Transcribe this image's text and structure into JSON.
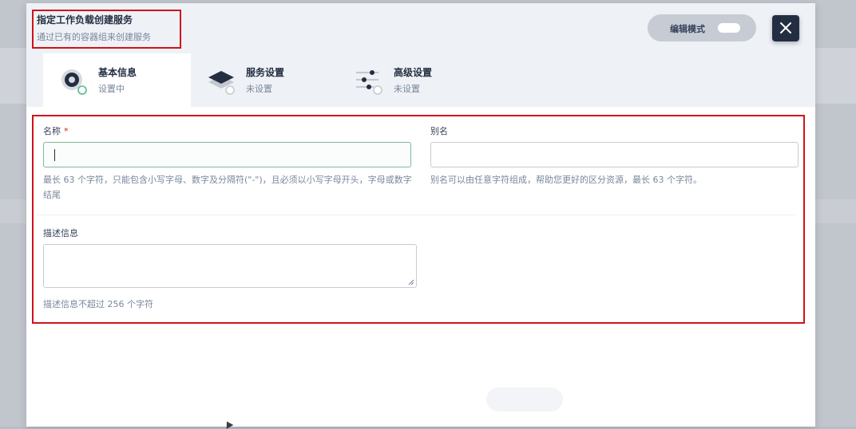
{
  "header": {
    "title": "指定工作负载创建服务",
    "subtitle": "通过已有的容器组来创建服务",
    "edit_mode_label": "编辑模式"
  },
  "steps": [
    {
      "title": "基本信息",
      "status": "设置中",
      "icon": "target-icon",
      "active": true
    },
    {
      "title": "服务设置",
      "status": "未设置",
      "icon": "layers-icon",
      "active": false
    },
    {
      "title": "高级设置",
      "status": "未设置",
      "icon": "sliders-icon",
      "active": false
    }
  ],
  "form": {
    "name": {
      "label": "名称",
      "required_mark": "*",
      "value": "",
      "hint": "最长 63 个字符，只能包含小写字母、数字及分隔符(\"-\")，且必须以小写字母开头，字母或数字结尾"
    },
    "alias": {
      "label": "别名",
      "value": "",
      "hint": "别名可以由任意字符组成，帮助您更好的区分资源，最长 63 个字符。"
    },
    "description": {
      "label": "描述信息",
      "value": "",
      "hint": "描述信息不超过 256 个字符"
    }
  },
  "colors": {
    "accent_dark": "#242e42",
    "highlight_red": "#d0121b",
    "success_green": "#55bc8a",
    "muted_text": "#79879c"
  }
}
